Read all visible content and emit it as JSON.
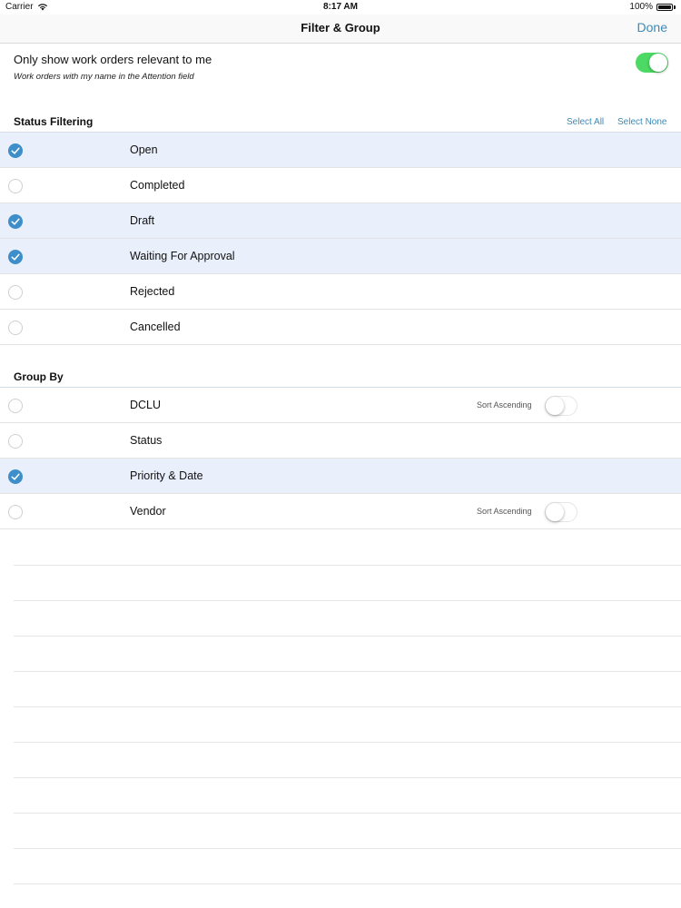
{
  "status_bar": {
    "carrier": "Carrier",
    "time": "8:17 AM",
    "battery": "100%"
  },
  "nav": {
    "title": "Filter & Group",
    "done_label": "Done"
  },
  "relevant": {
    "label": "Only show work orders relevant to me",
    "sublabel": "Work orders with my name in the Attention field",
    "enabled": true
  },
  "status_filtering": {
    "header": "Status Filtering",
    "select_all": "Select All",
    "select_none": "Select None",
    "items": [
      {
        "label": "Open",
        "checked": true
      },
      {
        "label": "Completed",
        "checked": false
      },
      {
        "label": "Draft",
        "checked": true
      },
      {
        "label": "Waiting For Approval",
        "checked": true
      },
      {
        "label": "Rejected",
        "checked": false
      },
      {
        "label": "Cancelled",
        "checked": false
      }
    ]
  },
  "group_by": {
    "header": "Group By",
    "items": [
      {
        "label": "DCLU",
        "checked": false,
        "sort_label": "Sort Ascending",
        "sort_ascending": false
      },
      {
        "label": "Status",
        "checked": false
      },
      {
        "label": "Priority & Date",
        "checked": true
      },
      {
        "label": "Vendor",
        "checked": false,
        "sort_label": "Sort Ascending",
        "sort_ascending": false
      }
    ]
  },
  "colors": {
    "accent": "#3a8ab8",
    "check": "#3d8ec9",
    "toggle_on": "#4cd964",
    "row_selected": "#eaf0fb"
  }
}
